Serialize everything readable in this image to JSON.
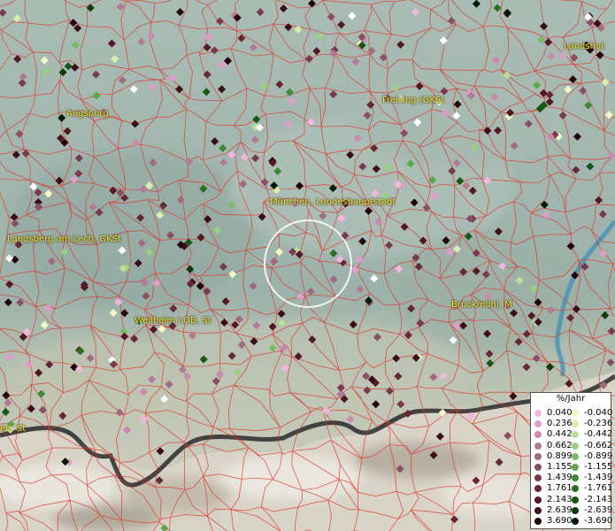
{
  "map": {
    "cities": [
      {
        "name": "Landshut",
        "label": "Landshut"
      },
      {
        "name": "augsburg",
        "label": "Augsburg"
      },
      {
        "name": "freising",
        "label": "Freising (GKSt"
      },
      {
        "name": "muenchen",
        "label": "München, Landeshauptstadt"
      },
      {
        "name": "landsberg",
        "label": "Landsberg am Lech, GKSt"
      },
      {
        "name": "weilheim",
        "label": "Weilheim i.OB, St"
      },
      {
        "name": "bruckmuehl",
        "label": "Bruckmühl, M"
      },
      {
        "name": "partial",
        "label": "en, St"
      }
    ]
  },
  "legend": {
    "title": "%/Jahr",
    "positive": [
      {
        "value": "0.040",
        "color": "#f2b6e0"
      },
      {
        "value": "0.236",
        "color": "#e29ccb"
      },
      {
        "value": "0.442",
        "color": "#c98aae"
      },
      {
        "value": "0.662",
        "color": "#b27a96"
      },
      {
        "value": "0.899",
        "color": "#a06a80"
      },
      {
        "value": "1.155",
        "color": "#8a4f64"
      },
      {
        "value": "1.439",
        "color": "#7a3a4e"
      },
      {
        "value": "1.761",
        "color": "#662835"
      },
      {
        "value": "2.143",
        "color": "#541825"
      },
      {
        "value": "2.639",
        "color": "#3c0c18"
      },
      {
        "value": "3.690",
        "color": "#22030a"
      }
    ],
    "negative": [
      {
        "value": "-0.040",
        "color": "#f4f8c4"
      },
      {
        "value": "-0.236",
        "color": "#d9efb0"
      },
      {
        "value": "-0.442",
        "color": "#b8e09a"
      },
      {
        "value": "-0.662",
        "color": "#9bd080"
      },
      {
        "value": "-0.899",
        "color": "#7cba64"
      },
      {
        "value": "-1.155",
        "color": "#5ea64c"
      },
      {
        "value": "-1.439",
        "color": "#3e8a34"
      },
      {
        "value": "-1.761",
        "color": "#287022"
      },
      {
        "value": "-2.143",
        "color": "#165816"
      },
      {
        "value": "-2.639",
        "color": "#0a3c0c"
      },
      {
        "value": "-3.690",
        "color": "#021a04"
      }
    ]
  }
}
